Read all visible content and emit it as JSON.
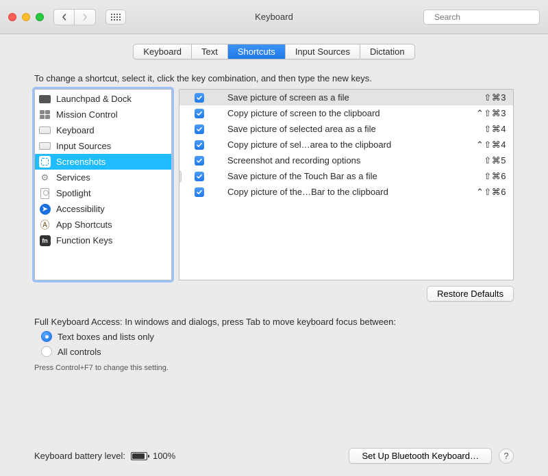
{
  "window": {
    "title": "Keyboard"
  },
  "search": {
    "placeholder": "Search"
  },
  "tabs": [
    "Keyboard",
    "Text",
    "Shortcuts",
    "Input Sources",
    "Dictation"
  ],
  "tabs_selected_index": 2,
  "instruction": "To change a shortcut, select it, click the key combination, and then type the new keys.",
  "categories": [
    {
      "label": "Launchpad & Dock",
      "icon": "launchpad"
    },
    {
      "label": "Mission Control",
      "icon": "mission"
    },
    {
      "label": "Keyboard",
      "icon": "keyboard"
    },
    {
      "label": "Input Sources",
      "icon": "keyboard"
    },
    {
      "label": "Screenshots",
      "icon": "screenshots",
      "selected": true
    },
    {
      "label": "Services",
      "icon": "gear"
    },
    {
      "label": "Spotlight",
      "icon": "spotlight"
    },
    {
      "label": "Accessibility",
      "icon": "access"
    },
    {
      "label": "App Shortcuts",
      "icon": "appsc"
    },
    {
      "label": "Function Keys",
      "icon": "fn"
    }
  ],
  "shortcuts": [
    {
      "enabled": true,
      "label": "Save picture of screen as a file",
      "keys": "⇧⌘3",
      "selected": true
    },
    {
      "enabled": true,
      "label": "Copy picture of screen to the clipboard",
      "keys": "⌃⇧⌘3"
    },
    {
      "enabled": true,
      "label": "Save picture of selected area as a file",
      "keys": "⇧⌘4"
    },
    {
      "enabled": true,
      "label": "Copy picture of sel…area to the clipboard",
      "keys": "⌃⇧⌘4"
    },
    {
      "enabled": true,
      "label": "Screenshot and recording options",
      "keys": "⇧⌘5"
    },
    {
      "enabled": true,
      "label": "Save picture of the Touch Bar as a file",
      "keys": "⇧⌘6"
    },
    {
      "enabled": true,
      "label": "Copy picture of the…Bar to the clipboard",
      "keys": "⌃⇧⌘6"
    }
  ],
  "restore_label": "Restore Defaults",
  "fka": {
    "prompt": "Full Keyboard Access: In windows and dialogs, press Tab to move keyboard focus between:",
    "options": [
      "Text boxes and lists only",
      "All controls"
    ],
    "selected_index": 0,
    "hint": "Press Control+F7 to change this setting."
  },
  "footer": {
    "battery_label": "Keyboard battery level:",
    "battery_pct": "100%",
    "bluetooth_label": "Set Up Bluetooth Keyboard…",
    "help": "?"
  }
}
